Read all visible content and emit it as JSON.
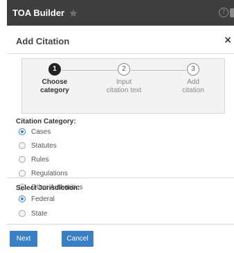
{
  "app": {
    "title": "TOA Builder"
  },
  "dialog": {
    "title": "Add Citation"
  },
  "steps": [
    {
      "number": "1",
      "line1": "Choose",
      "line2": "category",
      "active": true
    },
    {
      "number": "2",
      "line1": "Input",
      "line2": "citation text",
      "active": false
    },
    {
      "number": "3",
      "line1": "Add",
      "line2": "citation",
      "active": false
    }
  ],
  "citation_category": {
    "label": "Citation Category:",
    "selected": "Cases",
    "options": [
      "Cases",
      "Statutes",
      "Rules",
      "Regulations",
      "Other Authorities"
    ]
  },
  "jurisdiction": {
    "label": "Select Jurisdiction:",
    "selected": "Federal",
    "options": [
      "Federal",
      "State"
    ]
  },
  "buttons": {
    "next": "Next",
    "cancel": "Cancel"
  },
  "colors": {
    "titlebar": "#3e3e3e",
    "accent": "#3a7fc3"
  },
  "icons": {
    "star": "star-icon",
    "help": "help-icon",
    "close": "close-icon"
  }
}
